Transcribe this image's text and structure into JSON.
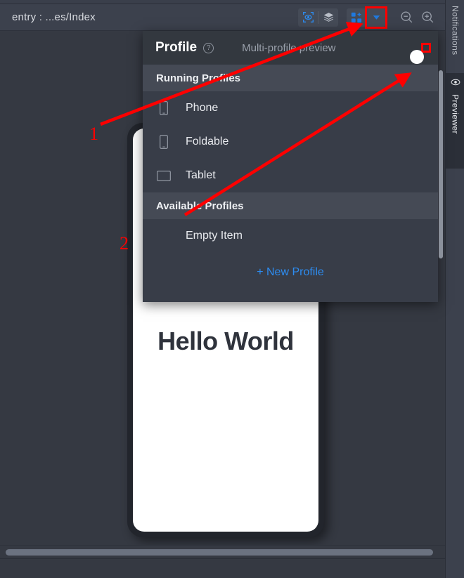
{
  "toolbar": {
    "title": "entry : ...es/Index",
    "buttons": [
      {
        "name": "inspector-icon",
        "label": "Inspector"
      },
      {
        "name": "layers-icon",
        "label": "Layers"
      },
      {
        "name": "multi-profile-grid-icon",
        "label": "Multi-profile"
      },
      {
        "name": "chevron-down-icon",
        "label": "Profile dropdown"
      },
      {
        "name": "zoom-out-icon",
        "label": "Zoom out"
      },
      {
        "name": "zoom-in-icon",
        "label": "Zoom in"
      }
    ]
  },
  "rail": {
    "notifications": "Notifications",
    "previewer": "Previewer"
  },
  "panel": {
    "title": "Profile",
    "help": "?",
    "subtitle": "Multi-profile preview",
    "toggle_on": true,
    "sections": [
      {
        "header": "Running Profiles",
        "items": [
          {
            "label": "Phone",
            "icon": "phone-icon"
          },
          {
            "label": "Foldable",
            "icon": "foldable-icon"
          },
          {
            "label": "Tablet",
            "icon": "tablet-icon"
          }
        ]
      },
      {
        "header": "Available Profiles",
        "items": [
          {
            "label": "Empty Item",
            "icon": "none"
          }
        ]
      }
    ],
    "footer_action": "+ New Profile"
  },
  "preview": {
    "hello_text": "Hello World"
  },
  "annotations": {
    "marker_one": "1",
    "marker_two": "2",
    "color": "#ff0000"
  },
  "colors": {
    "background": "#353942",
    "toolbar": "#3c414d",
    "panel": "#383d48",
    "panel_header": "#33383f",
    "section_header": "#454a55",
    "accent_blue": "#1877f2",
    "link_blue": "#2d8cf0",
    "highlight_red": "#ff0000"
  }
}
